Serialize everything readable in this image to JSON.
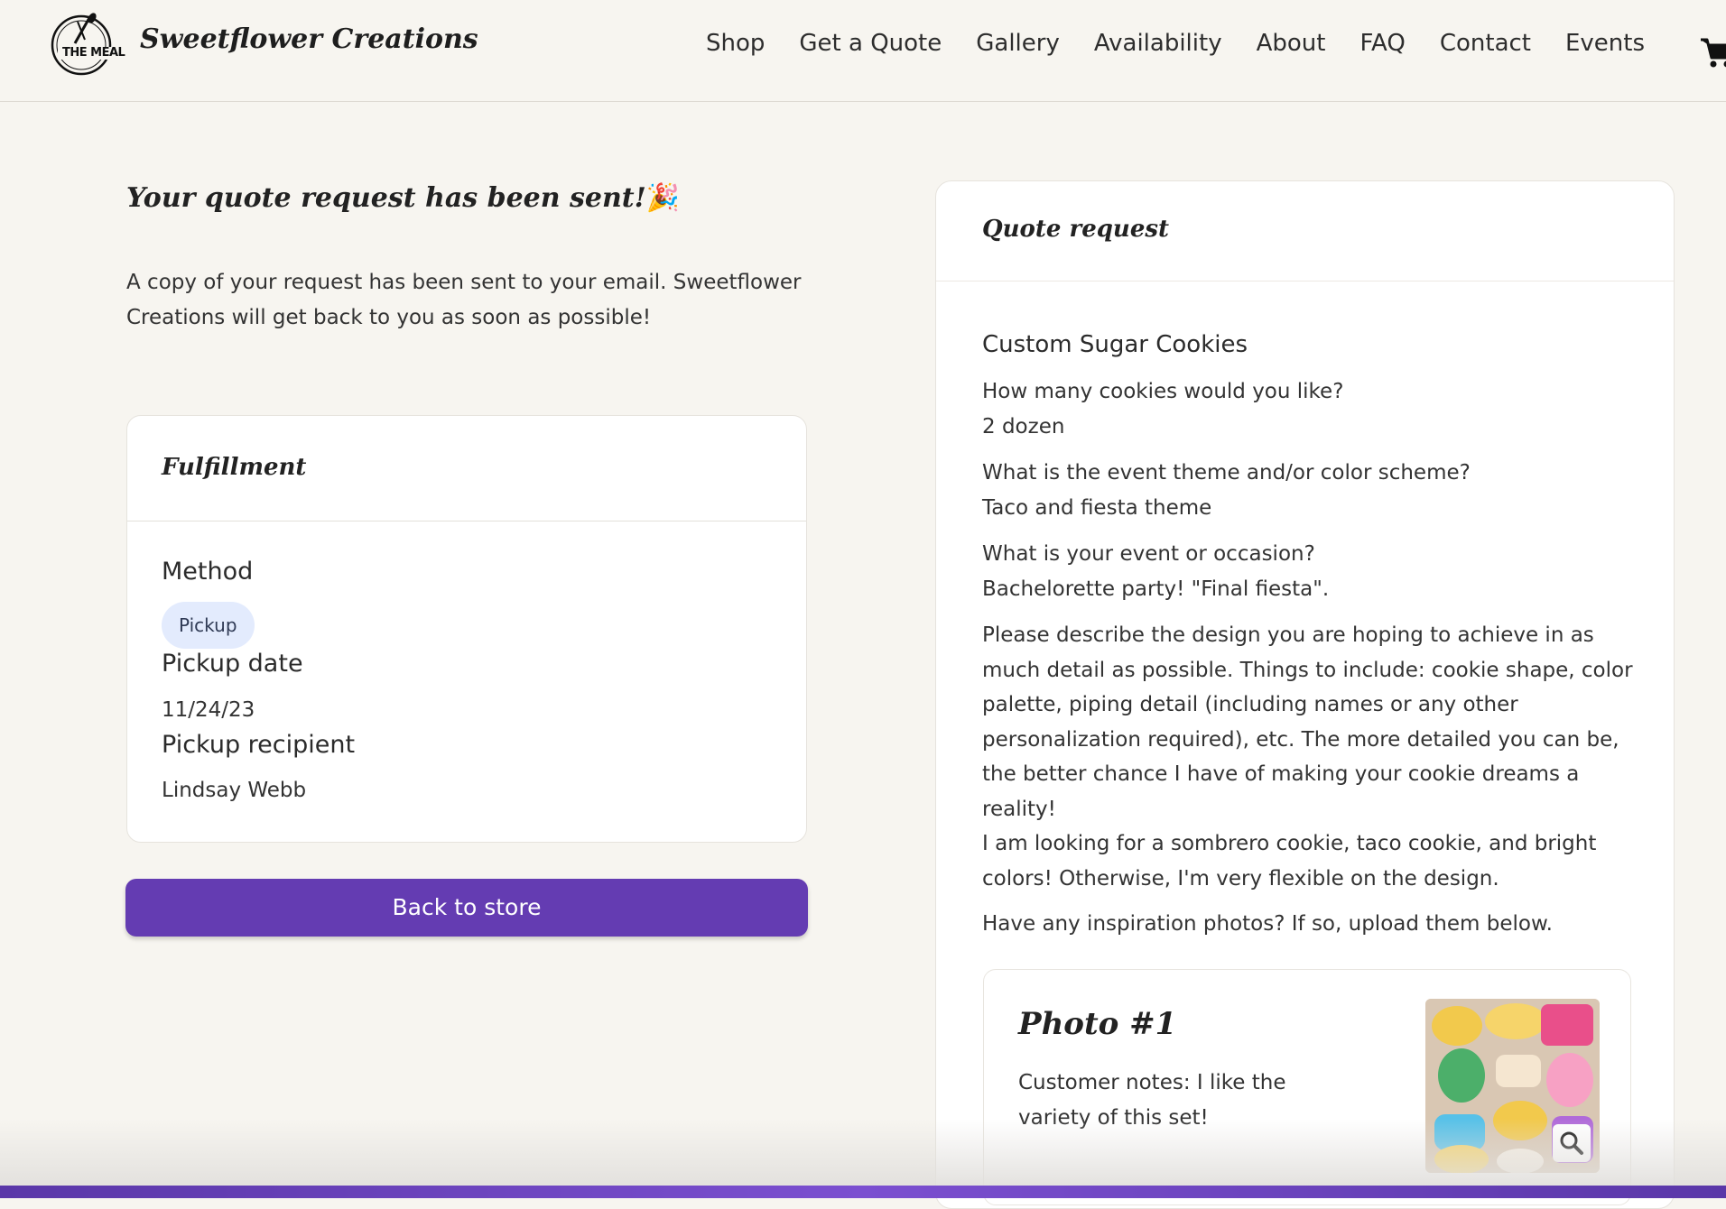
{
  "header": {
    "logo_text": "THE MEAL",
    "brand": "Sweetflower Creations",
    "nav": [
      "Shop",
      "Get a Quote",
      "Gallery",
      "Availability",
      "About",
      "FAQ",
      "Contact",
      "Events"
    ],
    "cart_icon": "shopping-cart-icon"
  },
  "confirmation": {
    "title": "Your quote request has been sent!",
    "emoji": "🎉",
    "message": "A copy of your request has been sent to your email. Sweetflower Creations will get back to you as soon as possible!"
  },
  "fulfillment": {
    "title": "Fulfillment",
    "method_label": "Method",
    "method_value": "Pickup",
    "date_label": "Pickup date",
    "date_value": "11/24/23",
    "recipient_label": "Pickup recipient",
    "recipient_value": "Lindsay Webb"
  },
  "back_button": "Back to store",
  "quote": {
    "title": "Quote request",
    "product": "Custom Sugar Cookies",
    "q1": "How many cookies would you like?",
    "a1": "2 dozen",
    "q2": "What is the event theme and/or color scheme?",
    "a2": "Taco and fiesta theme",
    "q3": "What is your event or occasion?",
    "a3": "Bachelorette party! \"Final fiesta\".",
    "q4": "Please describe the design you are hoping to achieve in as much detail as possible. Things to include: cookie shape, color palette, piping detail (including names or any other personalization required), etc. The more detailed you can be, the better chance I have of making your cookie dreams a reality!",
    "a4": "I am looking for a sombrero cookie, taco cookie, and bright colors! Otherwise, I'm very flexible on the design.",
    "q5": "Have any inspiration photos? If so, upload them below.",
    "photo": {
      "title": "Photo #1",
      "notes": "Customer notes: I like the variety of this set!",
      "zoom_icon": "magnifier-icon"
    }
  },
  "colors": {
    "background": "#f7f5f0",
    "primary_button": "#643cb2",
    "pill": "#e3ebfd"
  }
}
